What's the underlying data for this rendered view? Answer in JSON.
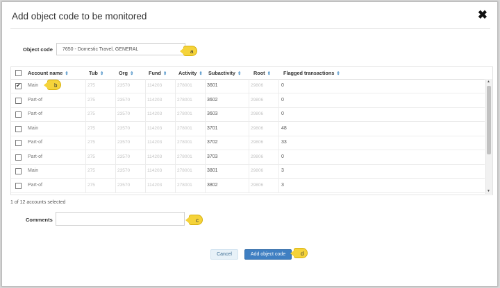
{
  "dialog": {
    "title": "Add object code to be monitored",
    "close_symbol": "✖"
  },
  "object_code": {
    "label": "Object code",
    "value": "7650 - Domestic Travel, GENERAL"
  },
  "table": {
    "columns": [
      "Account name",
      "Tub",
      "Org",
      "Fund",
      "Activity",
      "Subactivity",
      "Root",
      "Flagged transactions"
    ],
    "sort_symbol": "⇕",
    "rows": [
      {
        "checked": true,
        "account": "Main",
        "tub": "275",
        "org": "23570",
        "fund": "114203",
        "activity": "278001",
        "subactivity": "3601",
        "root": "29806",
        "flagged": "0"
      },
      {
        "checked": false,
        "account": "Part-of",
        "tub": "275",
        "org": "23570",
        "fund": "114203",
        "activity": "278001",
        "subactivity": "3602",
        "root": "29806",
        "flagged": "0"
      },
      {
        "checked": false,
        "account": "Part-of",
        "tub": "275",
        "org": "23570",
        "fund": "114203",
        "activity": "278001",
        "subactivity": "3603",
        "root": "29806",
        "flagged": "0"
      },
      {
        "checked": false,
        "account": "Main",
        "tub": "275",
        "org": "23570",
        "fund": "114203",
        "activity": "278001",
        "subactivity": "3701",
        "root": "29806",
        "flagged": "48"
      },
      {
        "checked": false,
        "account": "Part-of",
        "tub": "275",
        "org": "23570",
        "fund": "114203",
        "activity": "278001",
        "subactivity": "3702",
        "root": "29806",
        "flagged": "33"
      },
      {
        "checked": false,
        "account": "Part-of",
        "tub": "275",
        "org": "23570",
        "fund": "114203",
        "activity": "278001",
        "subactivity": "3703",
        "root": "29806",
        "flagged": "0"
      },
      {
        "checked": false,
        "account": "Main",
        "tub": "275",
        "org": "23570",
        "fund": "114203",
        "activity": "278001",
        "subactivity": "3801",
        "root": "29806",
        "flagged": "3"
      },
      {
        "checked": false,
        "account": "Part-of",
        "tub": "275",
        "org": "23570",
        "fund": "114203",
        "activity": "278001",
        "subactivity": "3802",
        "root": "29806",
        "flagged": "3"
      }
    ]
  },
  "selection_status": "1 of 12 accounts selected",
  "comments": {
    "label": "Comments",
    "value": ""
  },
  "buttons": {
    "cancel": "Cancel",
    "add": "Add object code"
  },
  "callouts": {
    "a": "a",
    "b": "b",
    "c": "c",
    "d": "d"
  },
  "colors": {
    "primary": "#3f7fc2",
    "callout": "#f5d33a"
  }
}
